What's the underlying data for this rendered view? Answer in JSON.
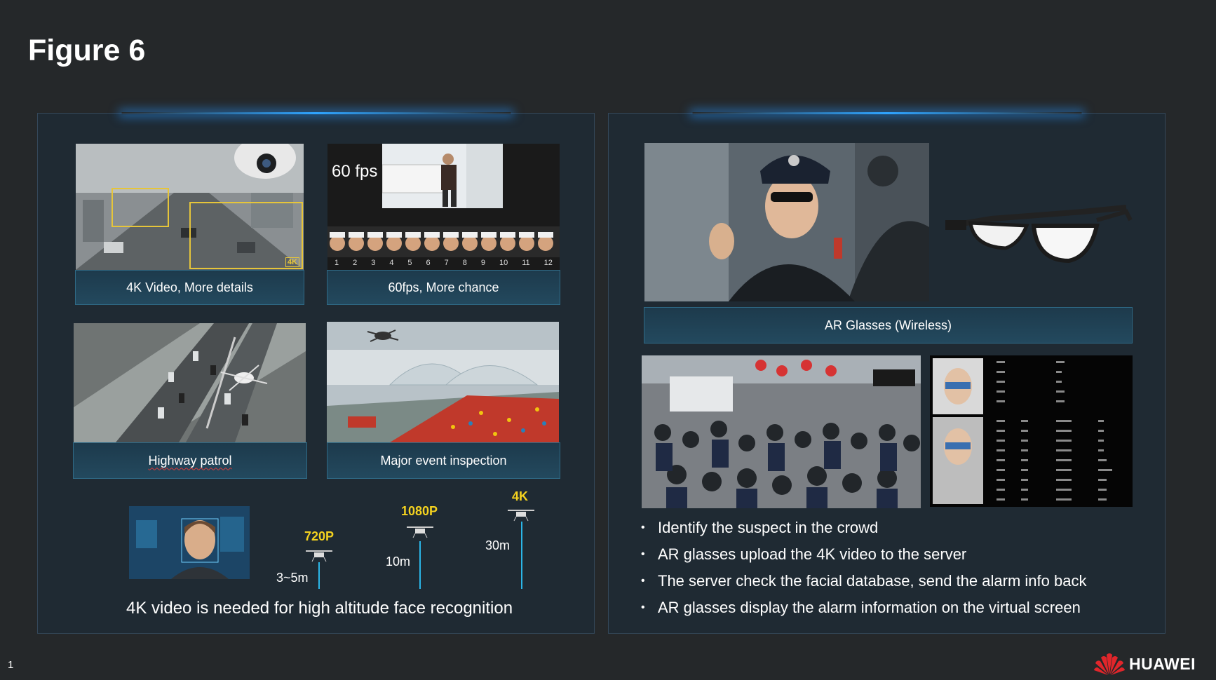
{
  "title": "Figure 6",
  "page_number": "1",
  "brand": "HUAWEI",
  "left_panel": {
    "tiles": [
      {
        "caption": "4K Video, More details",
        "overlay_badge": "4K"
      },
      {
        "caption": "60fps, More chance",
        "overlay_text": "60 fps",
        "frame_numbers": [
          "1",
          "2",
          "3",
          "4",
          "5",
          "6",
          "7",
          "8",
          "9",
          "10",
          "11",
          "12"
        ]
      },
      {
        "caption": "Highway patrol"
      },
      {
        "caption": "Major event inspection"
      }
    ],
    "altitude": {
      "res_720": "720P",
      "dist_720": "3~5m",
      "res_1080": "1080P",
      "dist_1080": "10m",
      "res_4k": "4K",
      "dist_4k": "30m"
    },
    "footer": "4K video is needed for high altitude face recognition"
  },
  "right_panel": {
    "ar_caption": "AR Glasses (Wireless)",
    "bullets": [
      "Identify the suspect in the crowd",
      "AR glasses upload the 4K video to the server",
      "The server check the facial database, send the alarm info back",
      "AR glasses display the alarm information on the virtual screen"
    ]
  },
  "colors": {
    "background": "#25282a",
    "panel": "#1f2a33",
    "accent": "#2bb6e8",
    "resolution_label": "#f4d21f",
    "logo_red": "#e0262b"
  }
}
